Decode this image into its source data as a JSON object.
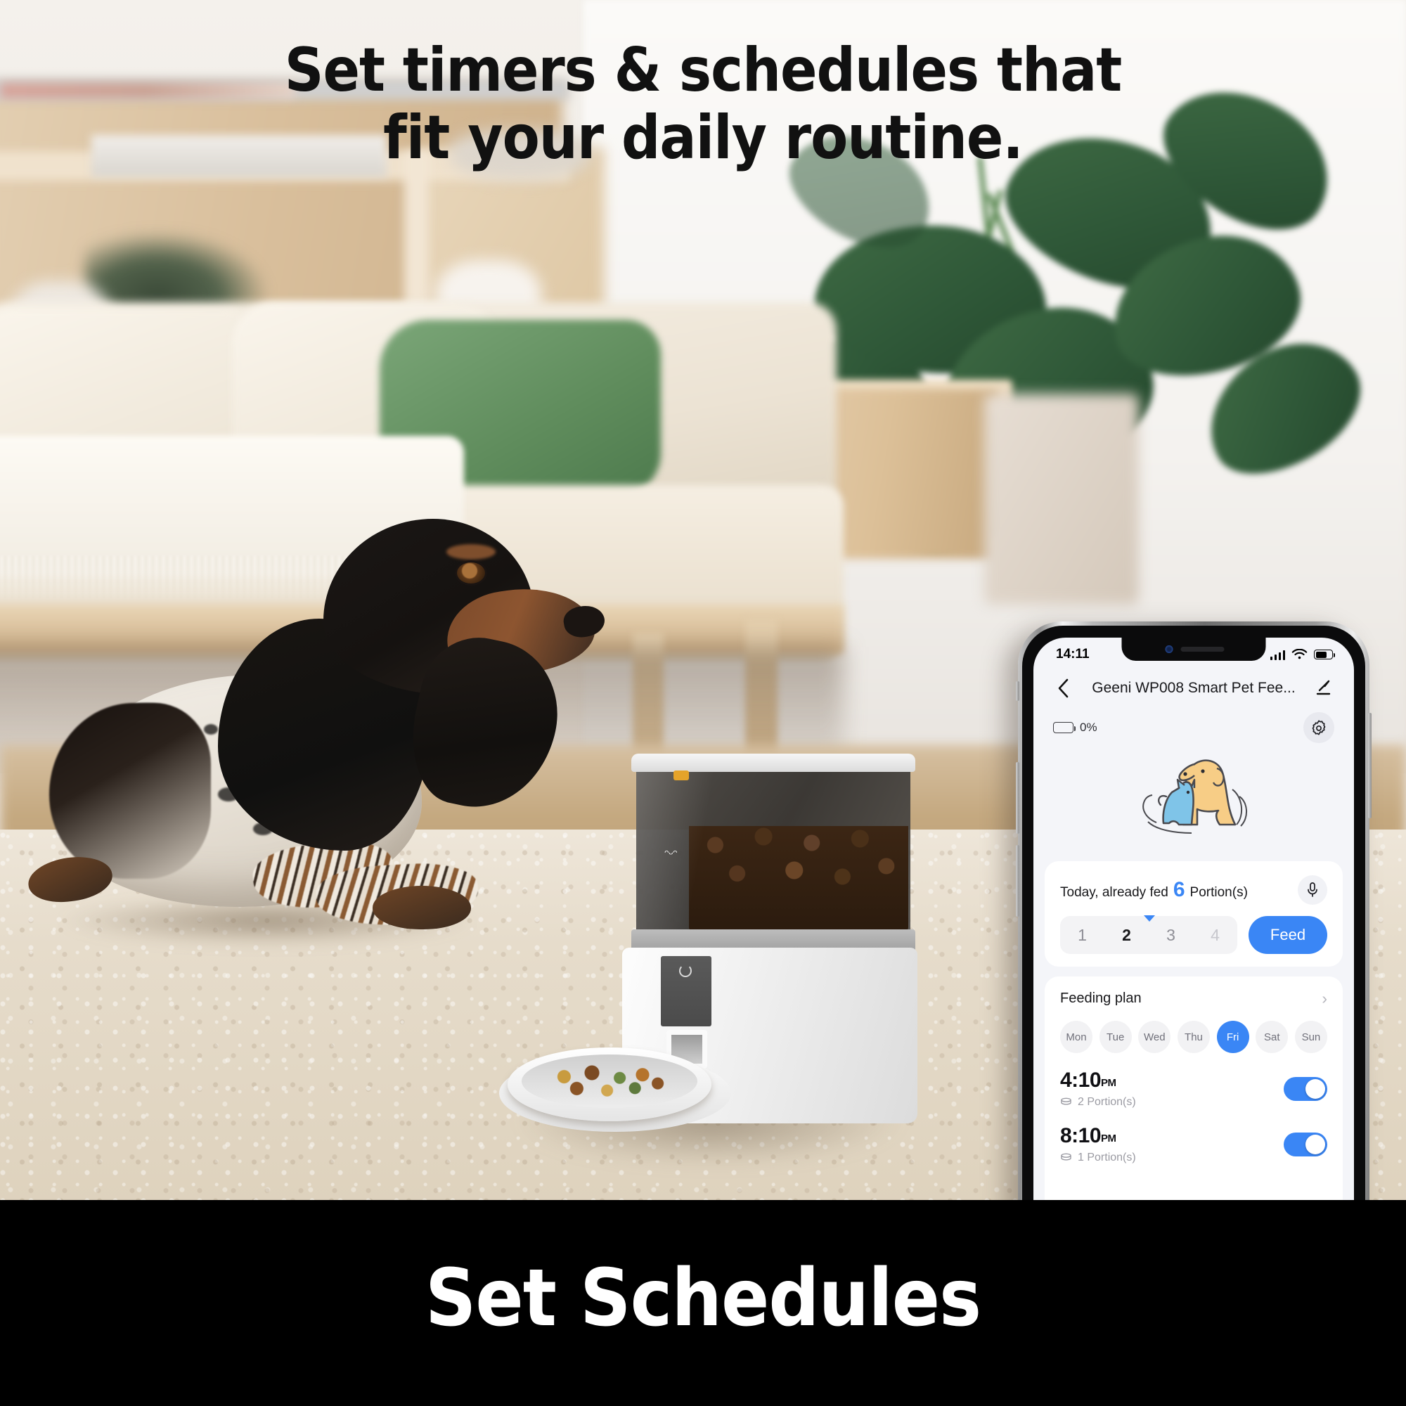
{
  "headline": {
    "line1": "Set timers & schedules that",
    "line2": "fit your daily routine."
  },
  "banner": {
    "text": "Set Schedules"
  },
  "phone": {
    "status": {
      "time": "14:11",
      "signal_icon": "signal-bars-icon",
      "wifi_icon": "wifi-icon",
      "battery_icon": "battery-icon"
    },
    "nav": {
      "back_icon": "chevron-left-icon",
      "title": "Geeni WP008 Smart Pet Fee...",
      "edit_icon": "pencil-edit-icon"
    },
    "device": {
      "battery_label": "0%",
      "battery_icon": "battery-outline-icon",
      "settings_icon": "gear-icon",
      "illustration": "dog-and-cat-icon"
    },
    "feed_card": {
      "label_prefix": "Today, already fed",
      "count": "6",
      "label_suffix": "Portion(s)",
      "mic_icon": "microphone-icon",
      "portions": [
        "1",
        "2",
        "3",
        "4"
      ],
      "selected_portion": "2",
      "feed_button": "Feed"
    },
    "plan_card": {
      "title": "Feeding plan",
      "chevron_icon": "chevron-right-icon",
      "days": [
        "Mon",
        "Tue",
        "Wed",
        "Thu",
        "Fri",
        "Sat",
        "Sun"
      ],
      "active_day": "Fri",
      "schedules": [
        {
          "time": "4:10",
          "meridiem": "PM",
          "portions": "2 Portion(s)",
          "portion_icon": "portion-stack-icon",
          "enabled": "on"
        },
        {
          "time": "8:10",
          "meridiem": "PM",
          "portions": "1 Portion(s)",
          "portion_icon": "portion-stack-icon",
          "enabled": "on"
        }
      ]
    }
  },
  "colors": {
    "accent_blue": "#3a86f5",
    "banner_bg": "#000000",
    "screen_bg": "#f4f5f9",
    "card_bg": "#ffffff",
    "pet_dog": "#f7cd86",
    "pet_cat": "#7fc4e8"
  }
}
